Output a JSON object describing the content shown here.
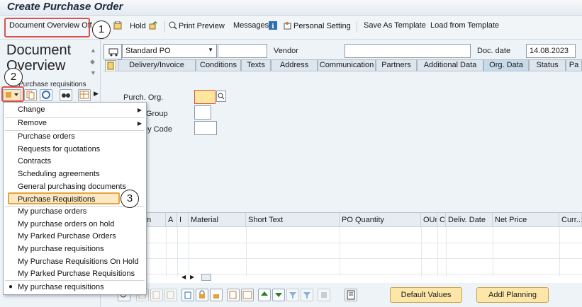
{
  "window": {
    "title": "Create Purchase Order"
  },
  "toolbar": {
    "doc_overview_off": "Document Overview Off",
    "hold": "Hold",
    "print_preview": "Print Preview",
    "messages": "Messages",
    "personal_setting": "Personal Setting",
    "save_as_template": "Save As Template",
    "load_from_template": "Load from Template"
  },
  "callouts": {
    "one": "1",
    "two": "2",
    "three": "3"
  },
  "left_panel": {
    "title_line1": "Document",
    "title_line2": "Overview",
    "obscured_text": "Purchase requisitions"
  },
  "menu": {
    "items": [
      {
        "label": "Change",
        "submenu": true
      },
      {
        "label": "Remove",
        "submenu": true
      },
      {
        "label": "Purchase orders"
      },
      {
        "label": "Requests for quotations"
      },
      {
        "label": "Contracts"
      },
      {
        "label": "Scheduling agreements"
      },
      {
        "label": "General purchasing documents"
      },
      {
        "label": "Purchase Requisitions"
      },
      {
        "label": "My purchase orders"
      },
      {
        "label": "My purchase orders on hold"
      },
      {
        "label": "My Parked Purchase Orders"
      },
      {
        "label": "My purchase requisitions"
      },
      {
        "label": "My Purchase Requisitions On Hold"
      },
      {
        "label": "My Parked Purchase Requisitions"
      },
      {
        "label": "My purchase requisitions"
      }
    ]
  },
  "header": {
    "doc_type": "Standard PO",
    "doc_number": "",
    "vendor_label": "Vendor",
    "vendor_value": "",
    "doc_date_label": "Doc. date",
    "doc_date_value": "14.08.2023"
  },
  "tabs": [
    "Delivery/Invoice",
    "Conditions",
    "Texts",
    "Address",
    "Communication",
    "Partners",
    "Additional Data",
    "Org. Data",
    "Status",
    "Pa"
  ],
  "org_data": {
    "purch_org_label": "Purch. Org.",
    "purch_group_label": "Group",
    "company_code_label": "ny Code"
  },
  "items_table": {
    "columns": [
      "tm",
      "A",
      "I",
      "Material",
      "Short Text",
      "PO Quantity",
      "OUn",
      "C",
      "Deliv. Date",
      "Net Price",
      "Curr..."
    ]
  },
  "bottom_bar": {
    "default_values": "Default Values",
    "addl_planning": "Addl Planning"
  },
  "colors": {
    "highlight": "#d9534f",
    "selection": "#e6a53d",
    "accent_button": "#fde6a8"
  }
}
